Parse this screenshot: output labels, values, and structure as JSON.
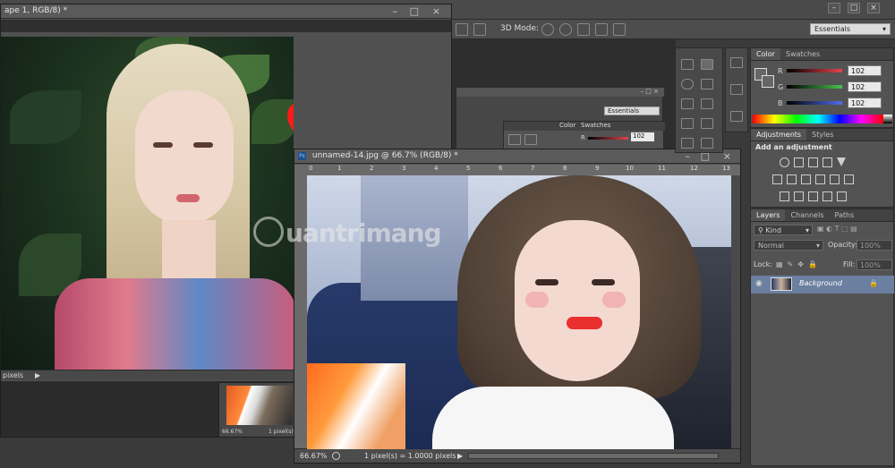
{
  "app": {
    "mode_label": "3D Mode:",
    "workspace": "Essentials",
    "window_buttons": [
      "–",
      "□",
      "×"
    ]
  },
  "doc_back": {
    "tab_title": "ape 1, RGB/8) *",
    "status": "pixels",
    "mini_status_zoom": "66.67%",
    "mini_status_info": "1 pixel(s)"
  },
  "doc_front": {
    "tab_title": "unnamed-14.jpg @ 66.7% (RGB/8) *",
    "ruler_ticks": [
      "0",
      "1",
      "2",
      "3",
      "4",
      "5",
      "6",
      "7",
      "8",
      "9",
      "10",
      "11",
      "12",
      "13"
    ],
    "status_zoom": "66.67%",
    "status_info": "1 pixel(s) = 1.0000 pixels"
  },
  "watermark": {
    "text": "uantrimang"
  },
  "mini_panel": {
    "workspace": "Essentials",
    "tabs": [
      "Color",
      "Swatches"
    ],
    "channel": "R",
    "value": "102"
  },
  "color_panel": {
    "tabs": [
      "Color",
      "Swatches"
    ],
    "rows": [
      {
        "label": "R",
        "value": "102",
        "color": "#e8434b"
      },
      {
        "label": "G",
        "value": "102",
        "color": "#49c24f"
      },
      {
        "label": "B",
        "value": "102",
        "color": "#4f6df0"
      }
    ]
  },
  "adjustments_panel": {
    "tabs": [
      "Adjustments",
      "Styles"
    ],
    "title": "Add an adjustment"
  },
  "layers_panel": {
    "tabs": [
      "Layers",
      "Channels",
      "Paths"
    ],
    "kind": "Kind",
    "blend_mode": "Normal",
    "opacity_label": "Opacity:",
    "opacity_value": "100%",
    "lock_label": "Lock:",
    "fill_label": "Fill:",
    "fill_value": "100%",
    "layer_name": "Background"
  }
}
